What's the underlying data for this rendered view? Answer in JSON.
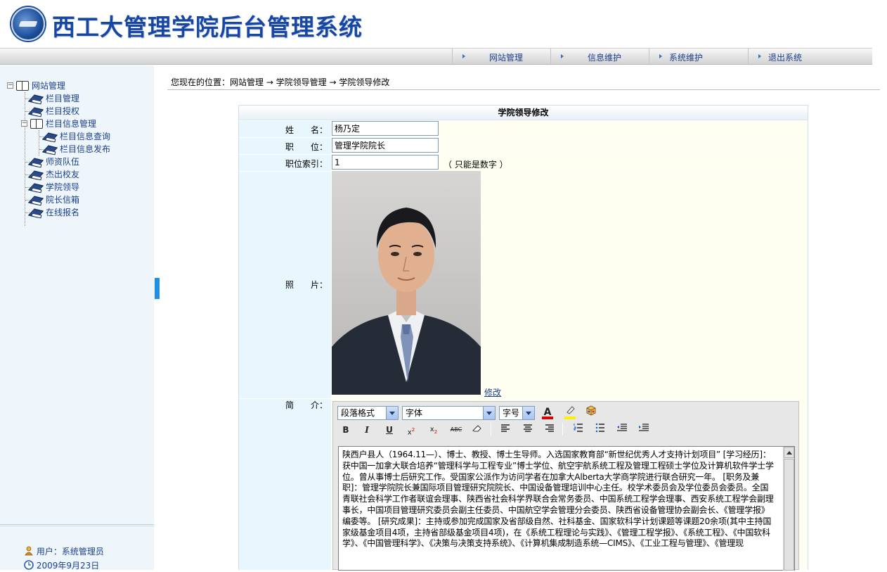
{
  "header": {
    "title": "西工大管理学院后台管理系统",
    "nav": [
      {
        "label": "网站管理"
      },
      {
        "label": "信息维护"
      },
      {
        "label": "系统维护"
      },
      {
        "label": "退出系统"
      }
    ]
  },
  "sidebar": {
    "root": "网站管理",
    "items": [
      {
        "label": "栏目管理"
      },
      {
        "label": "栏目授权"
      },
      {
        "label": "栏目信息管理"
      },
      {
        "label": "栏目信息查询"
      },
      {
        "label": "栏目信息发布"
      },
      {
        "label": "师资队伍"
      },
      {
        "label": "杰出校友"
      },
      {
        "label": "学院领导"
      },
      {
        "label": "院长信箱"
      },
      {
        "label": "在线报名"
      }
    ],
    "user_label": "用户：系统管理员",
    "date": "2009年9月23日"
  },
  "breadcrumb": "您现在的位置：网站管理 → 学院领导管理 → 学院领导修改",
  "form": {
    "heading": "学院领导修改",
    "name_label": "姓　　名：",
    "name_value": "杨乃定",
    "position_label": "职　　位：",
    "position_value": "管理学院院长",
    "index_label": "职位索引：",
    "index_value": "1",
    "index_note": "（ 只能是数字 ）",
    "photo_label": "照　　片：",
    "edit_link": "修改",
    "intro_label": "简　　介："
  },
  "editor": {
    "paragraph_format": "段落格式",
    "font": "字体",
    "font_size": "字号",
    "toolbar_icons": [
      "font-color-icon",
      "highlight-icon",
      "insert-object-icon",
      "bold-icon",
      "italic-icon",
      "underline-icon",
      "superscript-icon",
      "subscript-icon",
      "strikethrough-icon",
      "eraser-icon",
      "align-left-icon",
      "align-center-icon",
      "align-right-icon",
      "ordered-list-icon",
      "unordered-list-icon",
      "outdent-icon",
      "indent-icon"
    ],
    "content": "陕西户县人（1964.11—）、博士、教授、博士生导师。入选国家教育部“新世纪优秀人才支持计划项目” [学习经历]：获中国一加拿大联合培养“管理科学与工程专业”博士学位、航空宇航系统工程及管理工程硕士学位及计算机软件学士学位。曾从事博士后研究工作。受国家公派作为访问学者在加拿大Alberta大学商学院进行联合研究一年。 [职务及兼职]：管理学院院长兼国际项目管理研究院院长、中国设备管理培训中心主任。校学术委员会及学位委员会委员。全国青联社会科学工作者联谊会理事、陕西省社会科学界联合会常务委员、中国系统工程学会理事、西安系统工程学会副理事长，中国项目管理研究委员会副主任委员、中国航空学会管理分会委员、陕西省设备管理协会副会长、《管理学报》编委等。 [研究成果]：主持或参加完成国家及省部级自然、社科基金、国家软科学计划课题等课题20余项(其中主持国家级基金项目4项，主持省部级基金项目4项)，在《系统工程理论与实践》、《管理工程学报》、《系统工程》、《中国软科学》、《中国管理科学》、《决策与决策支持系统》、《计算机集成制造系统—CIMS》、《工业工程与管理》、《管理现"
  }
}
